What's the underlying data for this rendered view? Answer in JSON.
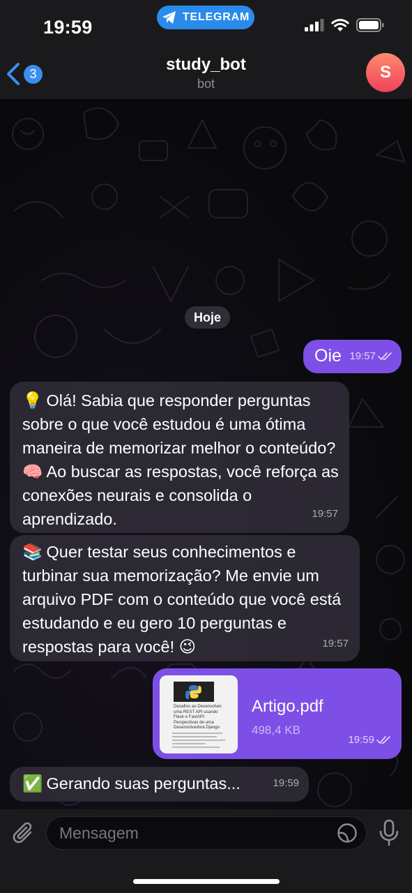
{
  "status_bar": {
    "time": "19:59",
    "app_pill": "TELEGRAM",
    "icons": [
      "signal-icon",
      "wifi-icon",
      "battery-icon"
    ]
  },
  "header": {
    "back_count": "3",
    "title": "study_bot",
    "subtitle": "bot",
    "avatar_letter": "S"
  },
  "chat": {
    "date_separator": "Hoje",
    "messages": [
      {
        "direction": "out",
        "text": "Oie",
        "time": "19:57",
        "status": "read"
      },
      {
        "direction": "in",
        "emoji": "💡",
        "text": "Olá! Sabia que responder perguntas sobre o que você estudou é uma ótima maneira de memorizar melhor o conteúdo? 🧠 Ao buscar as respostas, você reforça as conexões neurais e consolida o aprendizado.",
        "time": "19:57"
      },
      {
        "direction": "in",
        "emoji": "📚",
        "text": "Quer testar seus conhecimentos e turbinar sua memorização? Me envie um arquivo PDF com o conteúdo que você está estudando e eu gero 10 perguntas e respostas para você! 😉",
        "time": "19:57"
      },
      {
        "direction": "out",
        "type": "file",
        "file_name": "Artigo.pdf",
        "file_size": "498,4 KB",
        "time": "19:59",
        "status": "read",
        "thumb_title": "Desafios ao Desenvolver uma REST API usando Flask e FastAPI: Perspectivas de uma Desenvolvedora Django"
      },
      {
        "direction": "in",
        "emoji": "✅",
        "text": "Gerando suas perguntas...",
        "time": "19:59"
      }
    ]
  },
  "input": {
    "placeholder": "Mensagem"
  },
  "colors": {
    "outgoing_bubble": "#7e4fe6",
    "incoming_bubble": "#2e2a36",
    "accent": "#3a8ef0",
    "telegram_pill": "#2a8bea"
  }
}
